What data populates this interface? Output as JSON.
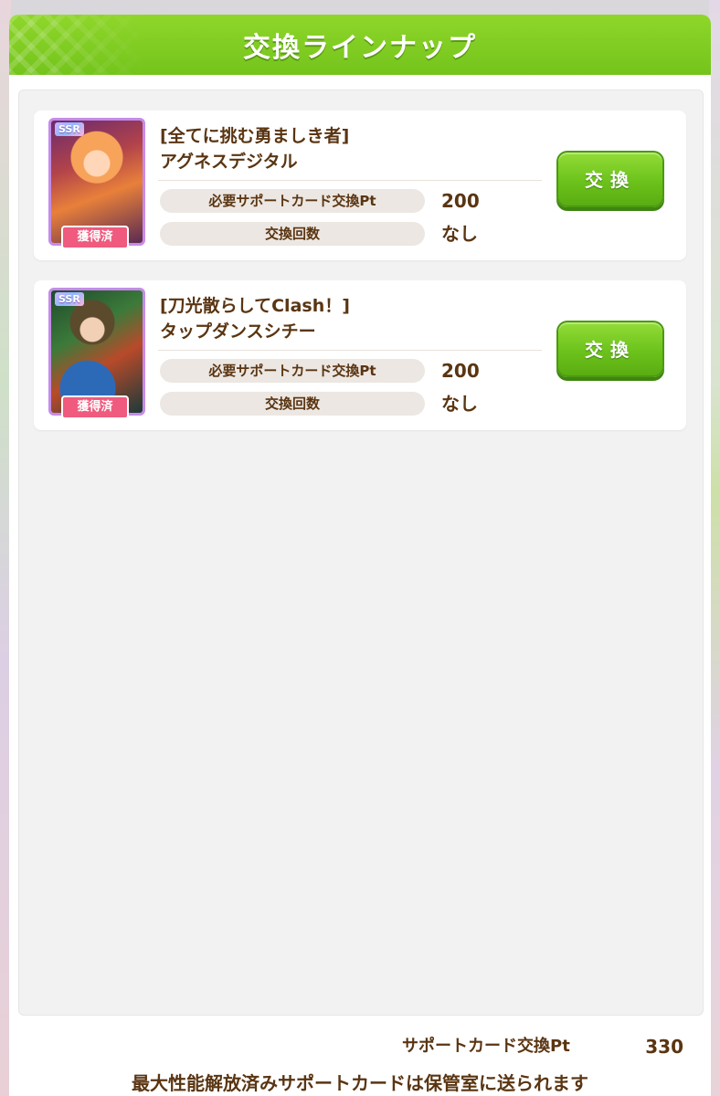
{
  "dialog": {
    "title": "交換ラインナップ"
  },
  "items": [
    {
      "rarity": "SSR",
      "owned_label": "獲得済",
      "title_line1": "[全てに挑む勇ましき者]",
      "title_line2": "アグネスデジタル",
      "cost_label": "必要サポートカード交換Pt",
      "cost_value": "200",
      "count_label": "交換回数",
      "count_value": "なし",
      "button_label": "交換"
    },
    {
      "rarity": "SSR",
      "owned_label": "獲得済",
      "title_line1": "[刀光散らしてClash！]",
      "title_line2": "タップダンスシチー",
      "cost_label": "必要サポートカード交換Pt",
      "cost_value": "200",
      "count_label": "交換回数",
      "count_value": "なし",
      "button_label": "交換"
    }
  ],
  "footer": {
    "pt_label": "サポートカード交換Pt",
    "pt_value": "330",
    "notice": "最大性能解放済みサポートカードは保管室に送られます"
  },
  "colors": {
    "header_green": "#7ccb22",
    "button_green": "#6cc21b",
    "text_brown": "#5a3512",
    "owned_pink": "#ef5a7e"
  }
}
